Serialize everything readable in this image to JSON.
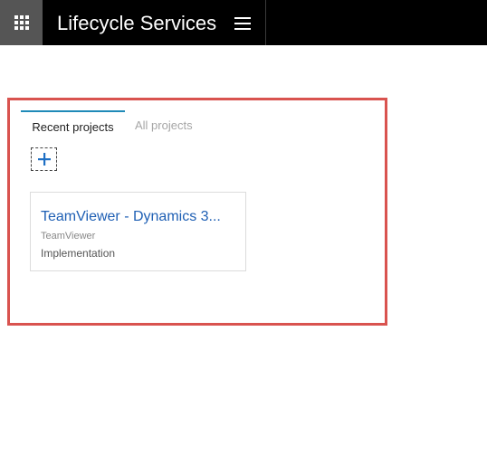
{
  "header": {
    "app_title": "Lifecycle Services",
    "launcher_icon": "waffle-icon",
    "menu_icon": "hamburger-icon"
  },
  "tabs": [
    {
      "label": "Recent projects",
      "active": true
    },
    {
      "label": "All projects",
      "active": false
    }
  ],
  "add_button": {
    "label": "+",
    "icon": "plus-icon"
  },
  "projects": [
    {
      "name": "TeamViewer - Dynamics 3...",
      "owner": "TeamViewer",
      "type": "Implementation"
    }
  ],
  "colors": {
    "topbar": "#000000",
    "launcher": "#555555",
    "accent": "#1f8ab8",
    "link": "#1e5fb4",
    "highlight": "#d9534f"
  }
}
